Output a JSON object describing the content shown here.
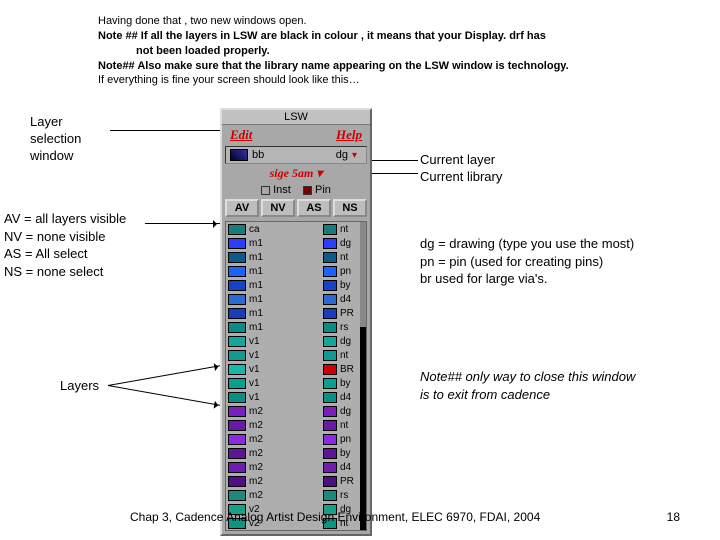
{
  "top": {
    "l1": "Having done that , two new windows open.",
    "l2": "Note ## If all the layers in LSW are black in colour , it means that your Display. drf has",
    "l3": "not been loaded properly.",
    "l4": "Note## Also make sure that the library name appearing on the LSW window is technology.",
    "l5": "If everything is fine your screen should look like this…"
  },
  "labels": {
    "lsw_line1": "Layer",
    "lsw_line2": "selection",
    "lsw_line3": "window",
    "av1": "AV = all layers visible",
    "av2": "NV = none visible",
    "av3": "AS = All select",
    "av4": "NS = none select",
    "layers": "Layers",
    "cur1": "Current layer",
    "cur2": "Current library",
    "dg1": "dg = drawing (type you use the most)",
    "dg2": "pn = pin   (used for creating pins)",
    "dg3": "br   used for large via's.",
    "note": "Note## only way to close this window is to exit from cadence"
  },
  "lsw": {
    "title": "LSW",
    "menu_edit": "Edit",
    "menu_help": "Help",
    "cur_name": "bb",
    "cur_type": "dg",
    "library": "sige 5am",
    "inst_label": "Inst",
    "pin_label": "Pin",
    "btns": [
      "AV",
      "NV",
      "AS",
      "NS"
    ],
    "rows": [
      {
        "c1": "#1b7a7a",
        "nm": "ca",
        "c2": "#1b7a7a",
        "ty": "nt"
      },
      {
        "c1": "#2e3cff",
        "nm": "m1",
        "c2": "#2e3cff",
        "ty": "dg"
      },
      {
        "c1": "#0a5a8a",
        "nm": "m1",
        "c2": "#0a5a8a",
        "ty": "nt"
      },
      {
        "c1": "#1b63ff",
        "nm": "m1",
        "c2": "#1b63ff",
        "ty": "pn"
      },
      {
        "c1": "#1642c8",
        "nm": "m1",
        "c2": "#1642c8",
        "ty": "by"
      },
      {
        "c1": "#2a6bd0",
        "nm": "m1",
        "c2": "#2a6bd0",
        "ty": "d4"
      },
      {
        "c1": "#1b3bbd",
        "nm": "m1",
        "c2": "#1b3bbd",
        "ty": "PR"
      },
      {
        "c1": "#0c8a84",
        "nm": "m1",
        "c2": "#0c8a84",
        "ty": "rs"
      },
      {
        "c1": "#11a79c",
        "nm": "v1",
        "c2": "#11a79c",
        "ty": "dg"
      },
      {
        "c1": "#0f9a92",
        "nm": "v1",
        "c2": "#0f9a92",
        "ty": "nt"
      },
      {
        "c1": "#18b8a8",
        "nm": "v1",
        "c2": "#c00",
        "ty": "BR"
      },
      {
        "c1": "#0aa08f",
        "nm": "v1",
        "c2": "#0aa08f",
        "ty": "by"
      },
      {
        "c1": "#0a8f84",
        "nm": "v1",
        "c2": "#0a8f84",
        "ty": "d4"
      },
      {
        "c1": "#7a1fbf",
        "nm": "m2",
        "c2": "#7a1fbf",
        "ty": "dg"
      },
      {
        "c1": "#6a18a8",
        "nm": "m2",
        "c2": "#6a18a8",
        "ty": "nt"
      },
      {
        "c1": "#8a2be2",
        "nm": "m2",
        "c2": "#8a2be2",
        "ty": "pn"
      },
      {
        "c1": "#5e1496",
        "nm": "m2",
        "c2": "#5e1496",
        "ty": "by"
      },
      {
        "c1": "#701cad",
        "nm": "m2",
        "c2": "#701cad",
        "ty": "d4"
      },
      {
        "c1": "#4e0f85",
        "nm": "m2",
        "c2": "#4e0f85",
        "ty": "PR"
      },
      {
        "c1": "#1b8a7a",
        "nm": "m2",
        "c2": "#1b8a7a",
        "ty": "rs"
      },
      {
        "c1": "#16a085",
        "nm": "v2",
        "c2": "#16a085",
        "ty": "dg"
      },
      {
        "c1": "#109480",
        "nm": "v2",
        "c2": "#109480",
        "ty": "nt"
      }
    ]
  },
  "footer": "Chap 3, Cadence Analog Artist Design Environment, ELEC 6970, FDAI, 2004",
  "page": "18"
}
